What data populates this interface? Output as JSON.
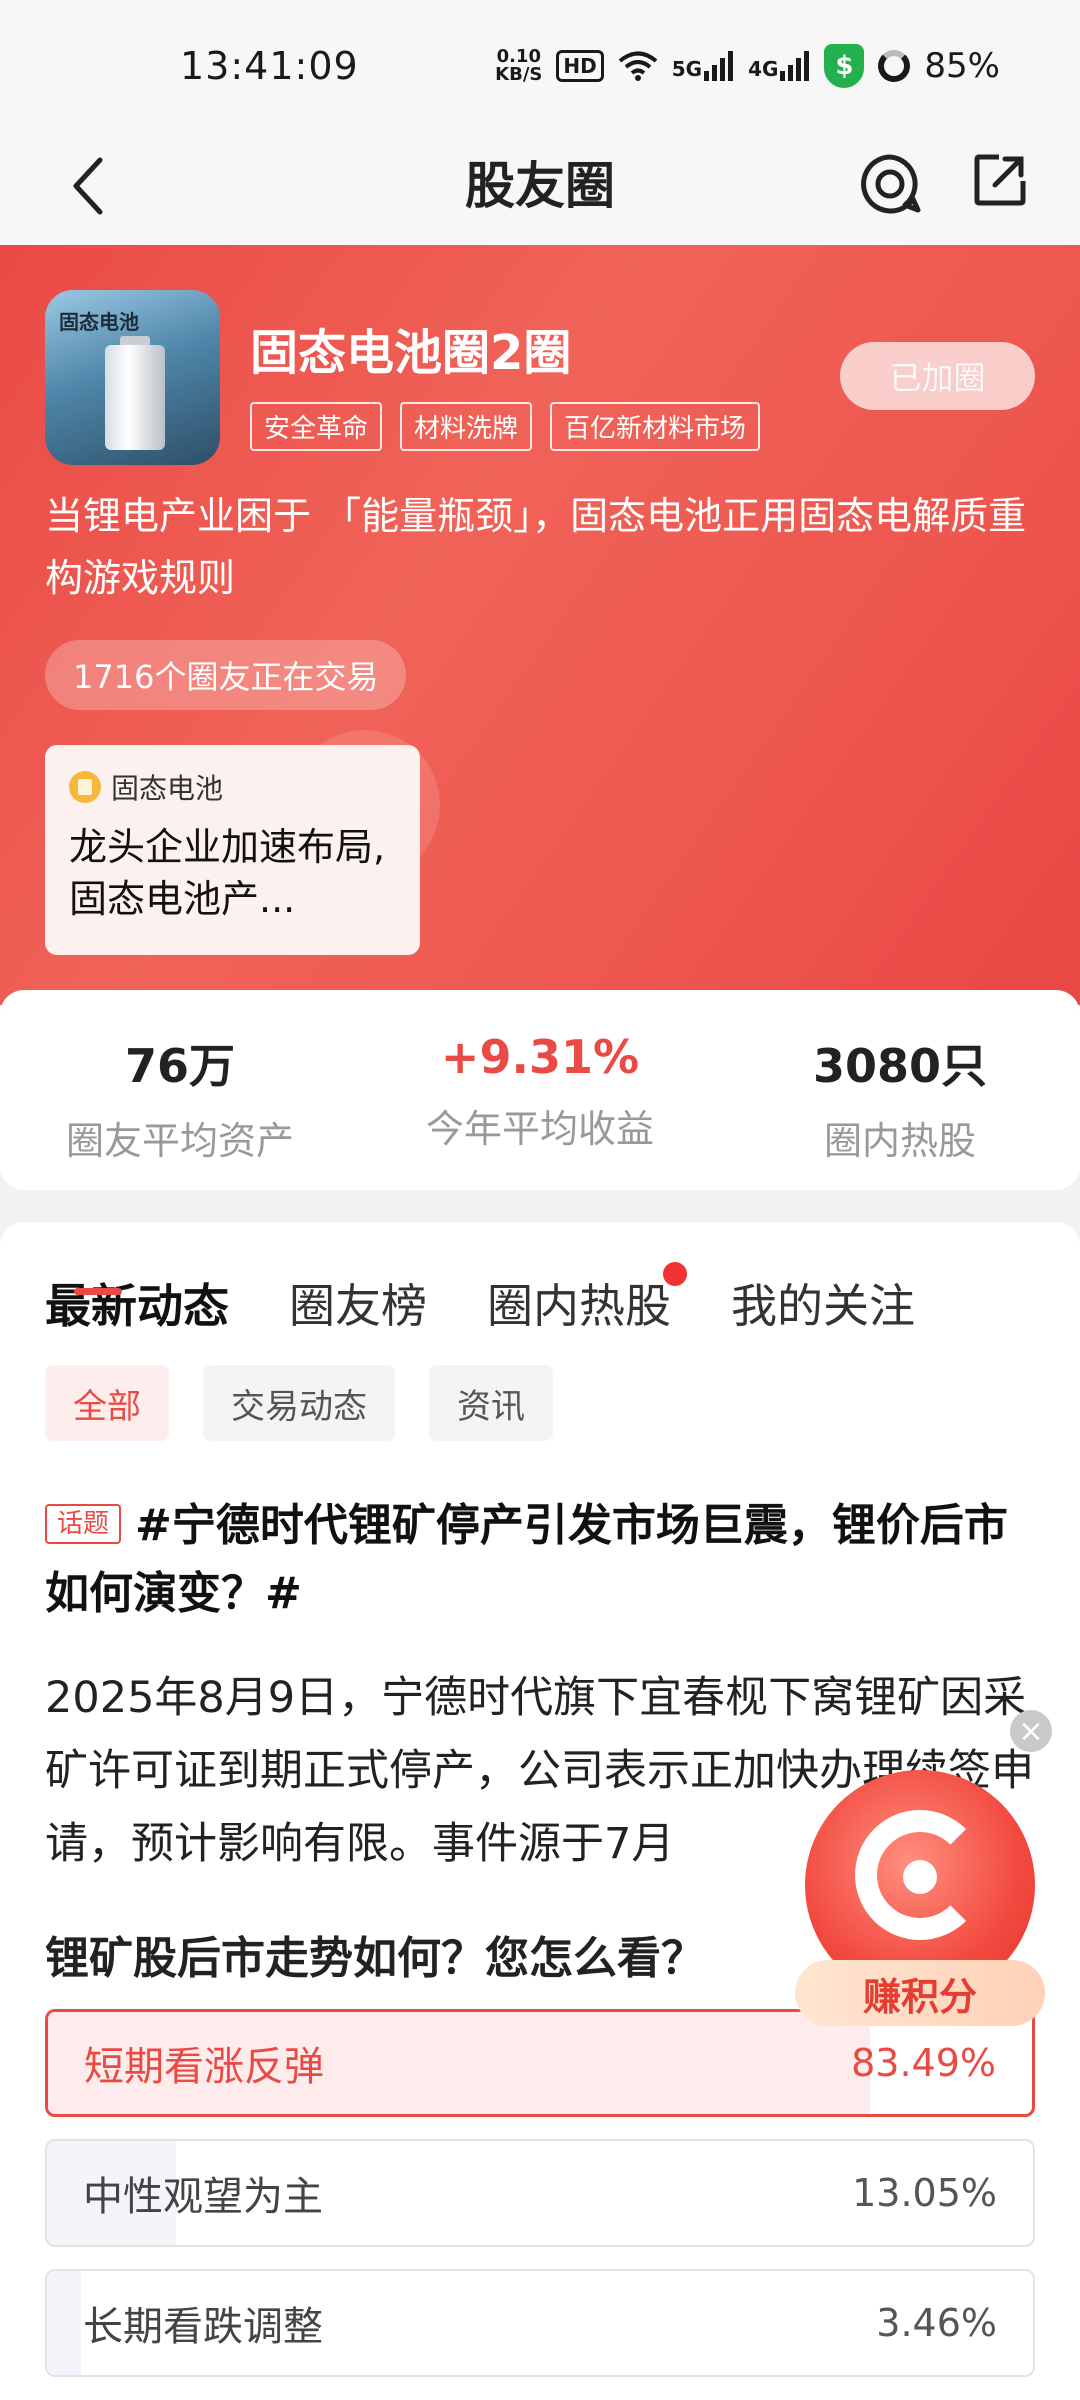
{
  "status_bar": {
    "time": "13:41:09",
    "net_speed_value": "0.10",
    "net_speed_unit": "KB/S",
    "hd": "HD",
    "sig1": "5G",
    "sig2": "4G",
    "battery": "85%"
  },
  "header": {
    "title": "股友圈"
  },
  "circle": {
    "avatar_text": "固态电池",
    "name": "固态电池圈2圈",
    "tags": [
      "安全革命",
      "材料洗牌",
      "百亿新材料市场"
    ],
    "join_status": "已加圈",
    "description": "当锂电产业困于 「能量瓶颈」，固态电池正用固态电解质重构游戏规则",
    "members_trading": "1716个圈友正在交易",
    "news_card": {
      "source": "固态电池",
      "title": "龙头企业加速布局, 固态电池产..."
    }
  },
  "stats": [
    {
      "value": "76万",
      "label": "圈友平均资产"
    },
    {
      "value": "+9.31%",
      "label": "今年平均收益"
    },
    {
      "value": "3080只",
      "label": "圈内热股"
    }
  ],
  "tabs": [
    "最新动态",
    "圈友榜",
    "圈内热股",
    "我的关注"
  ],
  "filters": [
    "全部",
    "交易动态",
    "资讯"
  ],
  "post": {
    "badge": "话题",
    "topic": "#宁德时代锂矿停产引发市场巨震，锂价后市如何演变？#",
    "body": "2025年8月9日，宁德时代旗下宜春枧下窝锂矿因采矿许可证到期正式停产，公司表示正加快办理续签申请，预计影响有限。事件源于7月",
    "poll_question": "锂矿股后市走势如何？您怎么看？",
    "poll_options": [
      {
        "label": "短期看涨反弹",
        "percent": "83.49%",
        "fraction": 0.8349,
        "selected": true
      },
      {
        "label": "中性观望为主",
        "percent": "13.05%",
        "fraction": 0.1305,
        "selected": false
      },
      {
        "label": "长期看跌调整",
        "percent": "3.46%",
        "fraction": 0.0346,
        "selected": false
      }
    ]
  },
  "floating": {
    "label": "赚积分",
    "close": "×"
  },
  "colors": {
    "accent": "#e94b44",
    "banner": "#ee5750"
  }
}
